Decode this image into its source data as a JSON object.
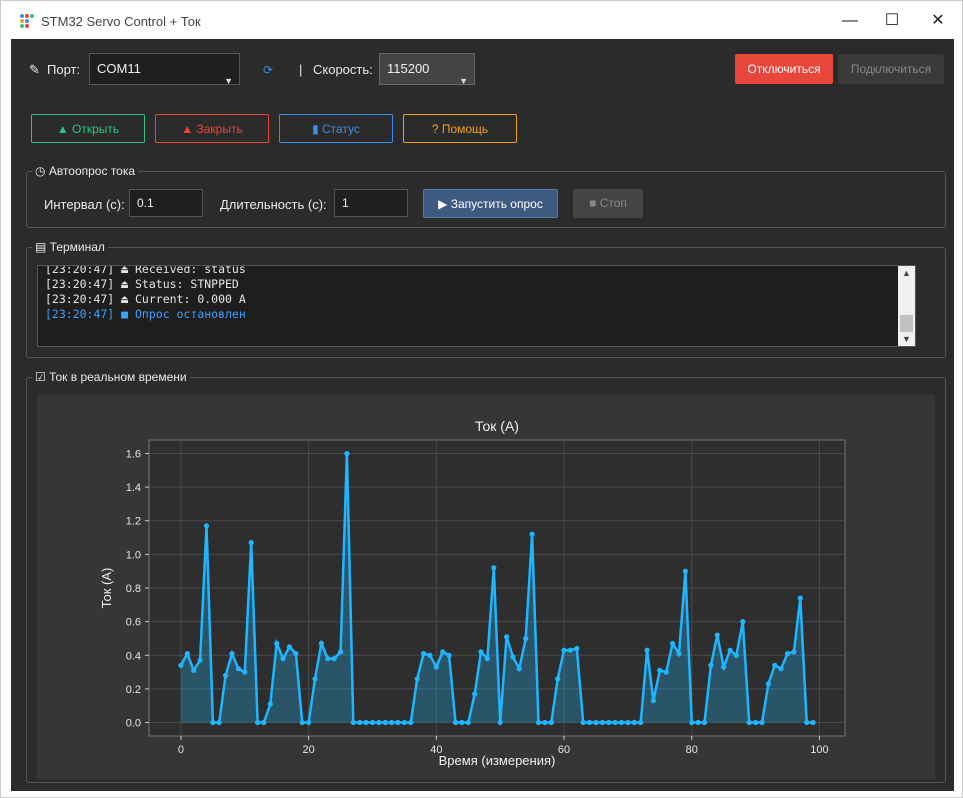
{
  "window": {
    "title": "STM32 Servo Control + Ток",
    "minimize": "—",
    "maximize": "☐",
    "close": "✕"
  },
  "toolbar": {
    "port_label": "Порт:",
    "port_value": "COM11",
    "separator": "|",
    "speed_label": "Скорость:",
    "speed_value": "115200",
    "disconnect_label": "Отключиться",
    "connect_label": "Подключиться",
    "open_label": "Открыть",
    "close_label": "Закрыть",
    "status_label": "Статус",
    "help_label": "Помощь"
  },
  "polling": {
    "title": "Автоопрос тока",
    "interval_label": "Интервал (с):",
    "interval_value": "0.1",
    "duration_label": "Длительность (с):",
    "duration_value": "1",
    "start_label": "Запустить опрос",
    "stop_label": "Стоп"
  },
  "terminal": {
    "title": "Терминал",
    "lines": [
      {
        "text": "[23:20:47] ⏏ Received: status",
        "color": "#e6e6e6"
      },
      {
        "text": "[23:20:47] ⏏ Status: STNPPED",
        "color": "#e6e6e6"
      },
      {
        "text": "[23:20:47] ⏏ Current: 0.000 A",
        "color": "#e6e6e6"
      },
      {
        "text": "[23:20:47] ■ Опрос остановлен",
        "color": "#3fa0ff"
      }
    ]
  },
  "realtime": {
    "title": "Ток в реальном времени"
  },
  "colors": {
    "accent": "#1fb6ff",
    "disconnect_bg": "#e8463b",
    "open_border": "#2ec27e",
    "close_border": "#e8463b",
    "status_border": "#3a8ee6",
    "help_border": "#f0a020",
    "start_bg": "#3d5a80"
  },
  "chart_data": {
    "type": "line",
    "title": "Ток (А)",
    "xlabel": "Время (измерения)",
    "ylabel": "Ток (А)",
    "xlim": [
      -5,
      104
    ],
    "ylim": [
      -0.08,
      1.68
    ],
    "xticks": [
      0,
      20,
      40,
      60,
      80,
      100
    ],
    "yticks": [
      0.0,
      0.2,
      0.4,
      0.6,
      0.8,
      1.0,
      1.2,
      1.4,
      1.6
    ],
    "grid": true,
    "series": [
      {
        "values": [
          0.34,
          0.41,
          0.31,
          0.37,
          1.17,
          0.0,
          0.0,
          0.28,
          0.41,
          0.32,
          0.3,
          1.07,
          0.0,
          0.0,
          0.11,
          0.47,
          0.38,
          0.45,
          0.41,
          0.0,
          0.0,
          0.26,
          0.47,
          0.38,
          0.38,
          0.42,
          1.6,
          0.0,
          0.0,
          0.0,
          0.0,
          0.0,
          0.0,
          0.0,
          0.0,
          0.0,
          0.0,
          0.26,
          0.41,
          0.4,
          0.33,
          0.42,
          0.4,
          0.0,
          0.0,
          0.0,
          0.17,
          0.42,
          0.38,
          0.92,
          0.0,
          0.51,
          0.39,
          0.32,
          0.5,
          1.12,
          0.0,
          0.0,
          0.0,
          0.26,
          0.43,
          0.43,
          0.44,
          0.0,
          0.0,
          0.0,
          0.0,
          0.0,
          0.0,
          0.0,
          0.0,
          0.0,
          0.0,
          0.43,
          0.13,
          0.31,
          0.3,
          0.47,
          0.41,
          0.9,
          0.0,
          0.0,
          0.0,
          0.34,
          0.52,
          0.33,
          0.43,
          0.4,
          0.6,
          0.0,
          0.0,
          0.0,
          0.23,
          0.34,
          0.32,
          0.41,
          0.42,
          0.74,
          0.0,
          0.0
        ]
      }
    ]
  }
}
